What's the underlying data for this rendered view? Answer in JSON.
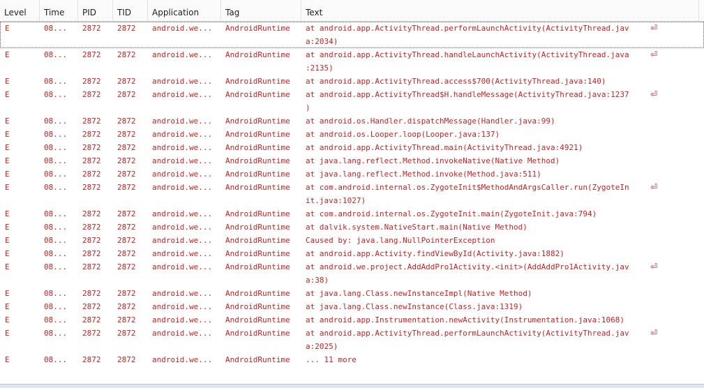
{
  "columns": {
    "level": "Level",
    "time": "Time",
    "pid": "PID",
    "tid": "TID",
    "application": "Application",
    "tag": "Tag",
    "text": "Text"
  },
  "row_defaults": {
    "level": "E",
    "time": "08...",
    "pid": "2872",
    "tid": "2872",
    "application": "android.we...",
    "tag": "AndroidRuntime"
  },
  "colors": {
    "error_text": "#d21f1f"
  },
  "wrap_icon": "⏎",
  "rows": [
    {
      "lines": [
        "at android.app.ActivityThread.performLaunchActivity(ActivityThread.jav",
        "a:2034)"
      ],
      "wrapped": true,
      "selected": true
    },
    {
      "lines": [
        "at android.app.ActivityThread.handleLaunchActivity(ActivityThread.java",
        ":2135)"
      ],
      "wrapped": true
    },
    {
      "lines": [
        "at android.app.ActivityThread.access$700(ActivityThread.java:140)"
      ]
    },
    {
      "lines": [
        "at android.app.ActivityThread$H.handleMessage(ActivityThread.java:1237",
        ")"
      ],
      "wrapped": true
    },
    {
      "lines": [
        "at android.os.Handler.dispatchMessage(Handler.java:99)"
      ]
    },
    {
      "lines": [
        "at android.os.Looper.loop(Looper.java:137)"
      ]
    },
    {
      "lines": [
        "at android.app.ActivityThread.main(ActivityThread.java:4921)"
      ]
    },
    {
      "lines": [
        "at java.lang.reflect.Method.invokeNative(Native Method)"
      ]
    },
    {
      "lines": [
        "at java.lang.reflect.Method.invoke(Method.java:511)"
      ]
    },
    {
      "lines": [
        "at com.android.internal.os.ZygoteInit$MethodAndArgsCaller.run(ZygoteIn",
        "it.java:1027)"
      ],
      "wrapped": true
    },
    {
      "lines": [
        "at com.android.internal.os.ZygoteInit.main(ZygoteInit.java:794)"
      ]
    },
    {
      "lines": [
        "at dalvik.system.NativeStart.main(Native Method)"
      ]
    },
    {
      "lines": [
        "Caused by: java.lang.NullPointerException"
      ]
    },
    {
      "lines": [
        "at android.app.Activity.findViewById(Activity.java:1882)"
      ]
    },
    {
      "lines": [
        "at android.we.project.AddAddPro1Activity.<init>(AddAddPro1Activity.jav",
        "a:38)"
      ],
      "wrapped": true
    },
    {
      "lines": [
        "at java.lang.Class.newInstanceImpl(Native Method)"
      ]
    },
    {
      "lines": [
        "at java.lang.Class.newInstance(Class.java:1319)"
      ]
    },
    {
      "lines": [
        "at android.app.Instrumentation.newActivity(Instrumentation.java:1068)"
      ]
    },
    {
      "lines": [
        "at android.app.ActivityThread.performLaunchActivity(ActivityThread.jav",
        "a:2025)"
      ],
      "wrapped": true
    },
    {
      "lines": [
        "... 11 more"
      ]
    }
  ]
}
